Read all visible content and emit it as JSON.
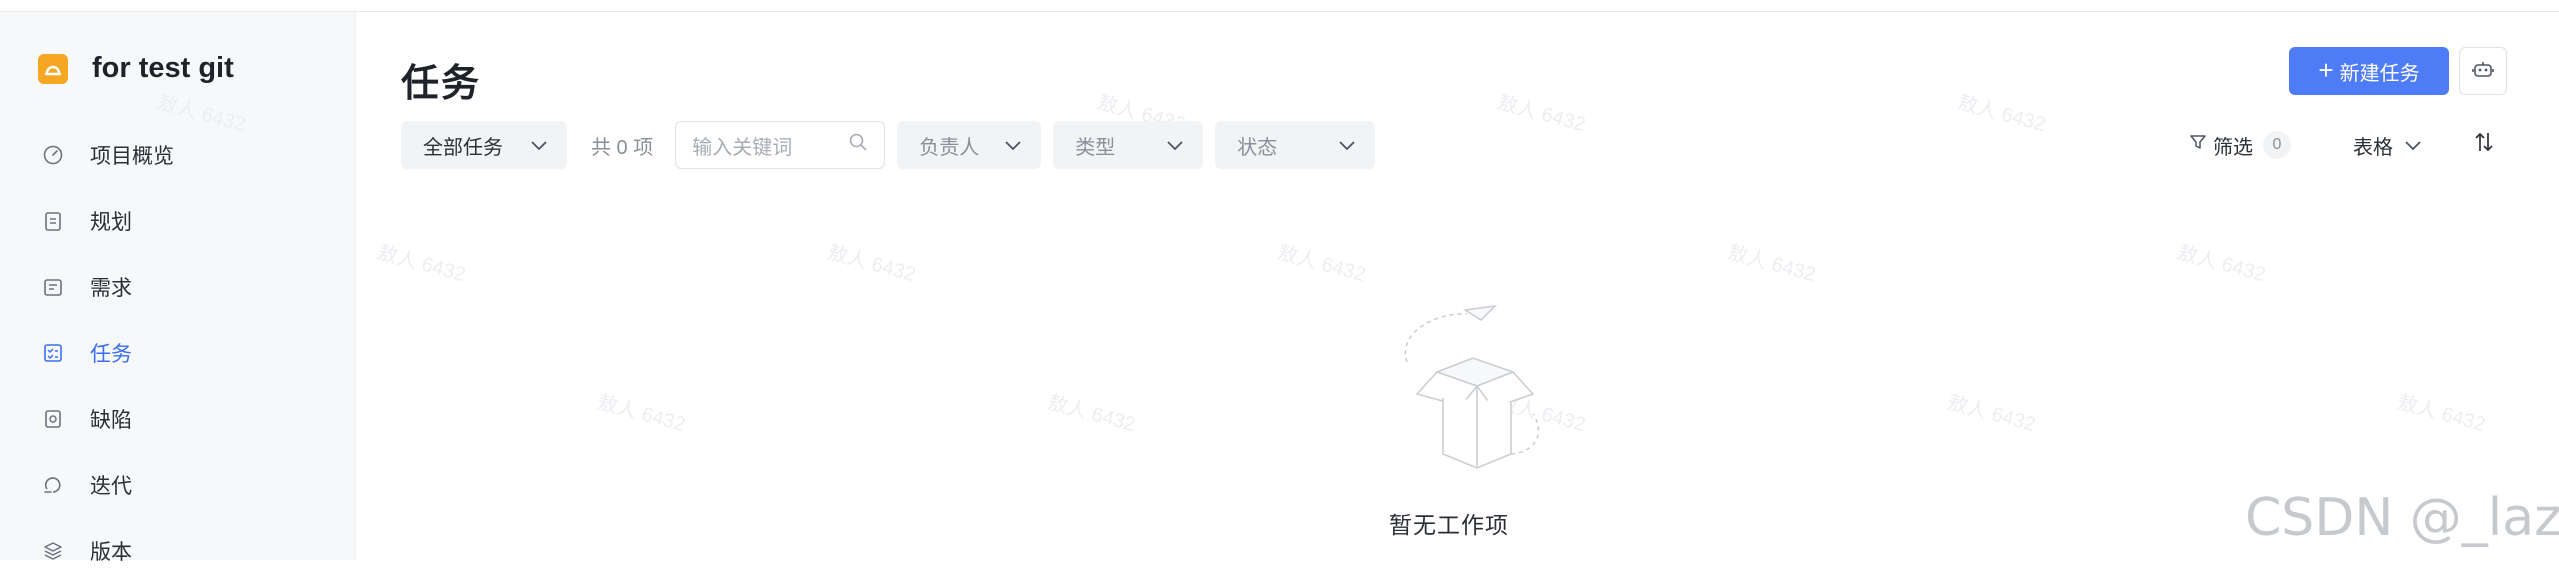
{
  "project": {
    "name": "for test git"
  },
  "sidebar": {
    "items": [
      {
        "label": "项目概览",
        "icon": "gauge-icon"
      },
      {
        "label": "规划",
        "icon": "clipboard-icon"
      },
      {
        "label": "需求",
        "icon": "requirement-icon"
      },
      {
        "label": "任务",
        "icon": "task-icon",
        "active": true
      },
      {
        "label": "缺陷",
        "icon": "bug-icon"
      },
      {
        "label": "迭代",
        "icon": "iteration-icon"
      },
      {
        "label": "版本",
        "icon": "layers-icon"
      }
    ]
  },
  "header": {
    "title": "任务",
    "new_button_label": "新建任务"
  },
  "filters": {
    "scope": "全部任务",
    "count_text": "共 0 项",
    "search_placeholder": "输入关键词",
    "assignee": "负责人",
    "type": "类型",
    "status": "状态",
    "filter_label": "筛选",
    "filter_count": "0",
    "view_label": "表格"
  },
  "empty_state": {
    "text": "暂无工作项"
  },
  "watermark": {
    "text": "敖人 6432",
    "corner": "CSDN @_lazy."
  },
  "colors": {
    "accent": "#4d7cf6",
    "logo": "#f5a623",
    "active_nav": "#3b6ff0"
  }
}
